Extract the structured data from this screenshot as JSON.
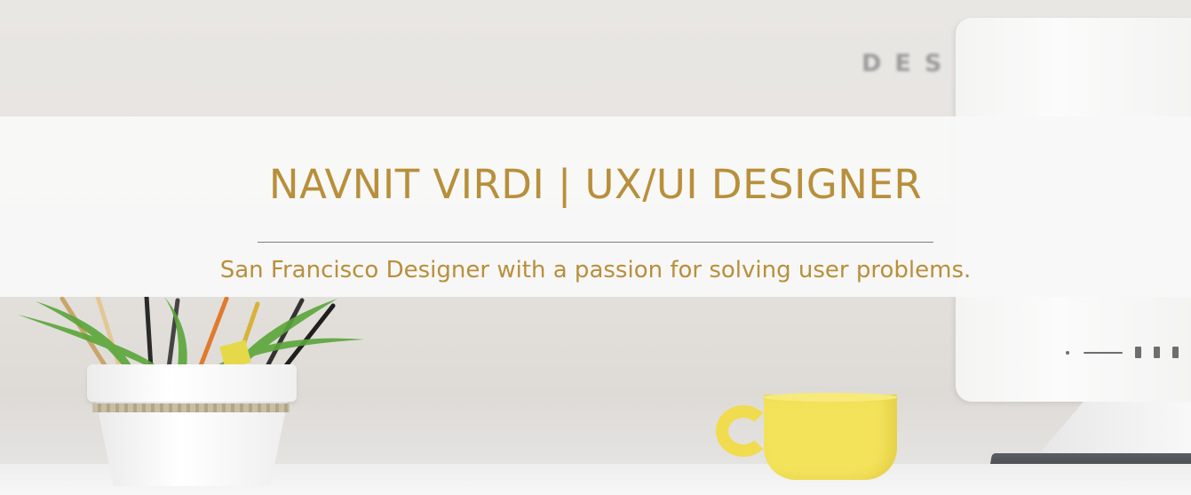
{
  "hero": {
    "title": "NAVNIT VIRDI | UX/UI DESIGNER",
    "subtitle": "San Francisco Designer with a passion for solving user problems.",
    "background_wall_text": "DES",
    "accent_color": "#b88f3b"
  },
  "background_objects": {
    "plant": "plant-pot-with-pencils",
    "cup": "yellow-coffee-cup",
    "monitor": "desktop-monitor",
    "keyboard": "keyboard"
  }
}
